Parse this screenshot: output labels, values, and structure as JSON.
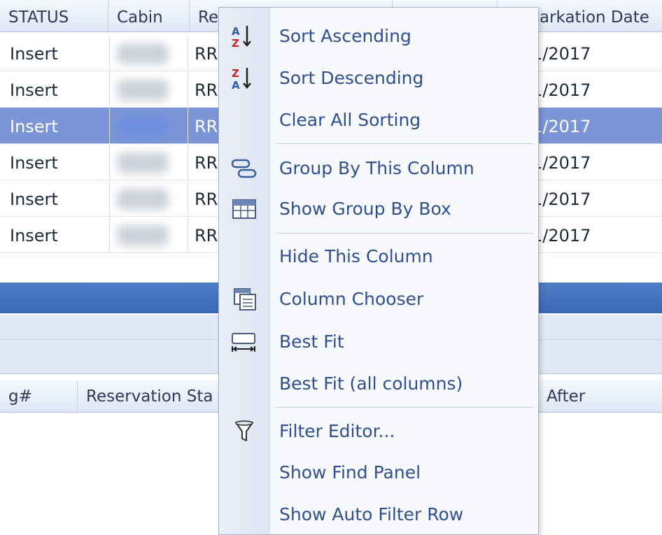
{
  "grid": {
    "headers": [
      "STATUS",
      "Cabin",
      "Re",
      "arkation Date"
    ],
    "rows": [
      {
        "status": "Insert",
        "res": "RR",
        "date": "1/2017"
      },
      {
        "status": "Insert",
        "res": "RR",
        "date": "1/2017"
      },
      {
        "status": "Insert",
        "res": "RR",
        "date": "1/2017"
      },
      {
        "status": "Insert",
        "res": "RR",
        "date": "1/2017"
      },
      {
        "status": "Insert",
        "res": "RR",
        "date": "1/2017"
      },
      {
        "status": "Insert",
        "res": "RR",
        "date": "1/2017"
      }
    ],
    "selected_row_index": 2
  },
  "lower_grid": {
    "headers": [
      "g#",
      "Reservation Sta",
      "After"
    ]
  },
  "context_menu": {
    "items": [
      {
        "label": "Sort Ascending",
        "icon": "sort-ascending-icon"
      },
      {
        "label": "Sort Descending",
        "icon": "sort-descending-icon"
      },
      {
        "label": "Clear All Sorting",
        "icon": ""
      },
      {
        "label": "Group By This Column",
        "icon": "group-by-column-icon"
      },
      {
        "label": "Show Group By Box",
        "icon": "group-by-box-icon"
      },
      {
        "label": "Hide This Column",
        "icon": ""
      },
      {
        "label": "Column Chooser",
        "icon": "column-chooser-icon"
      },
      {
        "label": "Best Fit",
        "icon": "best-fit-icon"
      },
      {
        "label": "Best Fit (all columns)",
        "icon": ""
      },
      {
        "label": "Filter Editor...",
        "icon": "filter-icon"
      },
      {
        "label": "Show Find Panel",
        "icon": ""
      },
      {
        "label": "Show Auto Filter Row",
        "icon": ""
      }
    ]
  },
  "colors": {
    "selection": "#7b95d6",
    "menu_text": "#2f4f8e",
    "band_dark": "#3a68b5",
    "sort_red": "#c0282e",
    "sort_blue": "#2f5fb0"
  }
}
